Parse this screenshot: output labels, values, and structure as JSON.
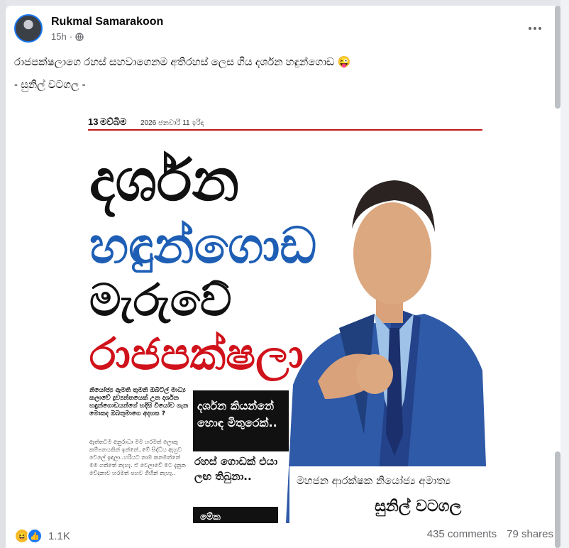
{
  "post": {
    "author": "Rukmal Samarakoon",
    "time": "15h",
    "dot": "·",
    "text_line1": "රාජපක්ෂලාගෙ රහස් සහවාගෙනම අතිරහස් ලෙස ගිය දර්ශන හඳුන්ගොඩ 😜",
    "text_line2": "- සුනිල් වටගල -"
  },
  "newspaper": {
    "masthead": "13",
    "masthead_name": "මව්බිම",
    "date": "2026 ජනවාරි 11 ඉරිදා",
    "headline1": "දර්ශන",
    "headline2": "හඳුන්ගොඩ",
    "headline3": "මැරුවේ",
    "headline4": "රාජපක්ෂලා",
    "lead_question": "නියෝජ්‍ය ඇමති තුමනි ඔබිට්ල් මාධ්‍ය කලාවේ ද්‍රව්‍යන්තයෙක් උන දර්ශන හඳුන්ගොඩයන්ගේ හදිසි වියෝව ගැන මොකද ඔබතුමාගෙ අදහස ?",
    "body_text": "ඇත්තටම අනුරාධා මම හරමත් ලොකු කම්පනයකින් ඉන්නේ..මේ සිද්ධිය ඇහුව වෙලේ ඉඳලා..හරියට තාම කනමත්නේ මම ගත්තේ නැහැ. ඒ වෙලාවේ මට දැනුන වේදනාව හරමත් පහව ගිහින් නැහැ..",
    "quote1": "දර්ශන කියන්නේ හොඳ මිතුරෙක්..",
    "quote2": "රහස් ගොඩක් එයා ලඟ තිබුනා..",
    "quote3": "මේක",
    "caption_title": "මහජන ආරක්ෂක නියෝජ්‍ය අමාත්‍ය",
    "caption_name": "සුනිල් වටගල"
  },
  "footer": {
    "reaction_count": "1.1K",
    "comments": "435 comments",
    "shares": "79 shares"
  },
  "icons": {
    "globe": "globe-icon",
    "more": "more-options-icon",
    "haha": "haha-reaction-icon",
    "like": "like-reaction-icon"
  },
  "colors": {
    "headline_black": "#111111",
    "headline_blue": "#1e5fb5",
    "headline_red": "#d0121b",
    "suit_blue": "#2f5aa8"
  }
}
